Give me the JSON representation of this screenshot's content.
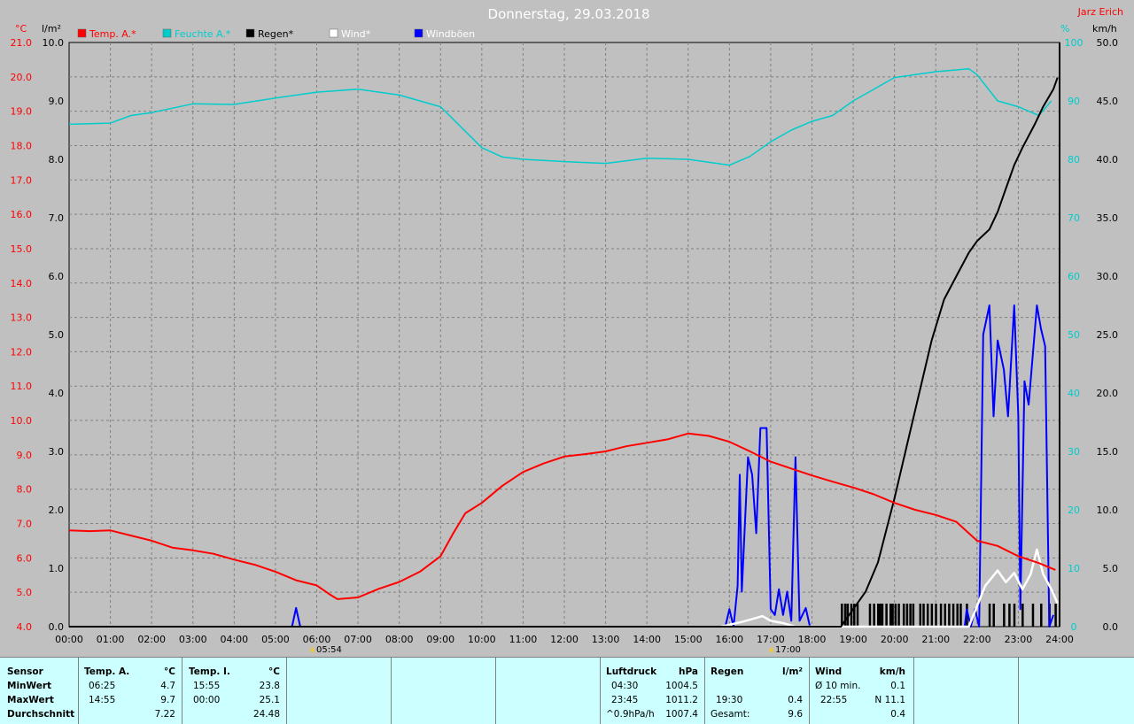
{
  "header": {
    "title": "Donnerstag, 29.03.2018",
    "author": "Jarz Erich"
  },
  "colors": {
    "temp": "#ff0000",
    "humidity": "#00cccc",
    "rain": "#000000",
    "wind": "#ffffff",
    "gust": "#0000ff",
    "background": "#c0c0c0",
    "grid": "#808080",
    "stats_bg": "#ccffff"
  },
  "axis_units": {
    "temp": "°C",
    "rain": "l/m²",
    "humidity": "%",
    "wind": "km/h"
  },
  "sun": {
    "sunrise": "05:54",
    "sunset": "17:00"
  },
  "chart_data": {
    "type": "line",
    "x_ticks": [
      "00:00",
      "01:00",
      "02:00",
      "03:00",
      "04:00",
      "05:00",
      "06:00",
      "07:00",
      "08:00",
      "09:00",
      "10:00",
      "11:00",
      "12:00",
      "13:00",
      "14:00",
      "15:00",
      "16:00",
      "17:00",
      "18:00",
      "19:00",
      "20:00",
      "21:00",
      "22:00",
      "23:00",
      "24:00"
    ],
    "xlim": [
      0,
      24
    ],
    "legend": [
      "Temp. A.*",
      "Feuchte A.*",
      "Regen*",
      "Wind*",
      "Windböen"
    ],
    "axes": {
      "temp": {
        "lim": [
          4.0,
          21.0
        ],
        "ticks": [
          4.0,
          5.0,
          6.0,
          7.0,
          8.0,
          9.0,
          10.0,
          11.0,
          12.0,
          13.0,
          14.0,
          15.0,
          16.0,
          17.0,
          18.0,
          19.0,
          20.0,
          21.0
        ]
      },
      "rain": {
        "lim": [
          0.0,
          10.0
        ],
        "ticks": [
          0.0,
          1.0,
          2.0,
          3.0,
          4.0,
          5.0,
          6.0,
          7.0,
          8.0,
          9.0,
          10.0
        ]
      },
      "humidity": {
        "lim": [
          0,
          100
        ],
        "ticks": [
          0,
          10,
          20,
          30,
          40,
          50,
          60,
          70,
          80,
          90,
          100
        ]
      },
      "wind": {
        "lim": [
          0.0,
          50.0
        ],
        "ticks": [
          0.0,
          5.0,
          10.0,
          15.0,
          20.0,
          25.0,
          30.0,
          35.0,
          40.0,
          45.0,
          50.0
        ]
      }
    },
    "series": [
      {
        "name": "Temp. A.*",
        "axis": "temp",
        "points": [
          [
            0,
            6.8
          ],
          [
            0.5,
            6.78
          ],
          [
            1,
            6.8
          ],
          [
            1.5,
            6.65
          ],
          [
            2,
            6.5
          ],
          [
            2.5,
            6.3
          ],
          [
            3,
            6.22
          ],
          [
            3.5,
            6.12
          ],
          [
            4,
            5.95
          ],
          [
            4.5,
            5.8
          ],
          [
            5,
            5.6
          ],
          [
            5.5,
            5.35
          ],
          [
            6,
            5.2
          ],
          [
            6.3,
            4.95
          ],
          [
            6.5,
            4.8
          ],
          [
            7,
            4.85
          ],
          [
            7.5,
            5.1
          ],
          [
            8,
            5.3
          ],
          [
            8.5,
            5.6
          ],
          [
            9,
            6.05
          ],
          [
            9.3,
            6.7
          ],
          [
            9.6,
            7.3
          ],
          [
            10,
            7.6
          ],
          [
            10.5,
            8.1
          ],
          [
            11,
            8.5
          ],
          [
            11.5,
            8.75
          ],
          [
            12,
            8.95
          ],
          [
            12.5,
            9.02
          ],
          [
            13,
            9.1
          ],
          [
            13.5,
            9.25
          ],
          [
            14,
            9.35
          ],
          [
            14.5,
            9.45
          ],
          [
            15,
            9.62
          ],
          [
            15.5,
            9.55
          ],
          [
            16,
            9.38
          ],
          [
            16.5,
            9.1
          ],
          [
            17,
            8.8
          ],
          [
            17.5,
            8.6
          ],
          [
            18,
            8.4
          ],
          [
            18.5,
            8.22
          ],
          [
            19,
            8.05
          ],
          [
            19.5,
            7.85
          ],
          [
            20,
            7.6
          ],
          [
            20.5,
            7.4
          ],
          [
            21,
            7.25
          ],
          [
            21.5,
            7.05
          ],
          [
            22,
            6.5
          ],
          [
            22.5,
            6.35
          ],
          [
            23,
            6.05
          ],
          [
            23.5,
            5.85
          ],
          [
            23.9,
            5.65
          ]
        ]
      },
      {
        "name": "Feuchte A.*",
        "axis": "humidity",
        "points": [
          [
            0,
            86
          ],
          [
            1,
            86.2
          ],
          [
            1.5,
            87.5
          ],
          [
            2,
            88
          ],
          [
            3,
            89.5
          ],
          [
            4,
            89.4
          ],
          [
            5,
            90.5
          ],
          [
            6,
            91.5
          ],
          [
            7,
            92
          ],
          [
            8,
            91
          ],
          [
            9,
            89
          ],
          [
            10,
            82
          ],
          [
            10.5,
            80.4
          ],
          [
            11,
            80
          ],
          [
            12,
            79.6
          ],
          [
            13,
            79.3
          ],
          [
            14,
            80.2
          ],
          [
            15,
            80
          ],
          [
            16,
            79
          ],
          [
            16.5,
            80.5
          ],
          [
            17,
            83
          ],
          [
            17.5,
            85
          ],
          [
            18,
            86.5
          ],
          [
            18.5,
            87.5
          ],
          [
            19,
            90
          ],
          [
            20,
            94
          ],
          [
            21,
            95
          ],
          [
            21.8,
            95.5
          ],
          [
            22,
            94.5
          ],
          [
            22.5,
            90
          ],
          [
            23,
            89
          ],
          [
            23.5,
            87.5
          ],
          [
            23.8,
            90
          ]
        ]
      },
      {
        "name": "Regen*",
        "axis": "rain",
        "points": [
          [
            0,
            0
          ],
          [
            18.7,
            0
          ],
          [
            19,
            0.3
          ],
          [
            19.3,
            0.6
          ],
          [
            19.6,
            1.1
          ],
          [
            20,
            2.2
          ],
          [
            20.3,
            3.1
          ],
          [
            20.6,
            4.0
          ],
          [
            20.9,
            4.9
          ],
          [
            21.2,
            5.6
          ],
          [
            21.5,
            6.0
          ],
          [
            21.8,
            6.4
          ],
          [
            22,
            6.6
          ],
          [
            22.3,
            6.8
          ],
          [
            22.5,
            7.1
          ],
          [
            22.7,
            7.5
          ],
          [
            22.9,
            7.9
          ],
          [
            23.1,
            8.2
          ],
          [
            23.4,
            8.6
          ],
          [
            23.6,
            8.9
          ],
          [
            23.85,
            9.2
          ],
          [
            23.95,
            9.4
          ]
        ]
      },
      {
        "name": "Wind*",
        "axis": "wind",
        "points": [
          [
            15.8,
            0
          ],
          [
            16.3,
            0.4
          ],
          [
            16.6,
            0.7
          ],
          [
            16.8,
            0.9
          ],
          [
            17,
            0.5
          ],
          [
            17.3,
            0.3
          ],
          [
            17.6,
            0
          ],
          [
            18,
            0
          ],
          [
            21.8,
            0
          ],
          [
            22.2,
            3.5
          ],
          [
            22.5,
            4.8
          ],
          [
            22.7,
            3.8
          ],
          [
            22.9,
            4.6
          ],
          [
            23.1,
            3.2
          ],
          [
            23.3,
            4.5
          ],
          [
            23.45,
            6.6
          ],
          [
            23.6,
            4.5
          ],
          [
            23.8,
            3.2
          ],
          [
            23.95,
            2.0
          ]
        ]
      },
      {
        "name": "Windböen",
        "axis": "gust",
        "points": [
          [
            0,
            0
          ],
          [
            5.4,
            0
          ],
          [
            5.5,
            1.6
          ],
          [
            5.6,
            0
          ],
          [
            15.9,
            0
          ],
          [
            16.0,
            1.5
          ],
          [
            16.1,
            0
          ],
          [
            16.2,
            3.5
          ],
          [
            16.25,
            13
          ],
          [
            16.3,
            3
          ],
          [
            16.45,
            14.5
          ],
          [
            16.55,
            13
          ],
          [
            16.65,
            8
          ],
          [
            16.75,
            17
          ],
          [
            16.9,
            17
          ],
          [
            17.0,
            1.5
          ],
          [
            17.1,
            1
          ],
          [
            17.2,
            3.2
          ],
          [
            17.3,
            1
          ],
          [
            17.4,
            3
          ],
          [
            17.5,
            0.5
          ],
          [
            17.6,
            14.5
          ],
          [
            17.7,
            0.5
          ],
          [
            17.85,
            1.6
          ],
          [
            17.95,
            0
          ],
          [
            21.7,
            0
          ],
          [
            21.75,
            1.5
          ],
          [
            21.85,
            0
          ],
          [
            21.95,
            1.5
          ],
          [
            22.05,
            0
          ],
          [
            22.15,
            25
          ],
          [
            22.3,
            27.5
          ],
          [
            22.4,
            18
          ],
          [
            22.5,
            24.5
          ],
          [
            22.65,
            22
          ],
          [
            22.75,
            18
          ],
          [
            22.9,
            27.5
          ],
          [
            23.0,
            18
          ],
          [
            23.05,
            1.5
          ],
          [
            23.15,
            21
          ],
          [
            23.25,
            19
          ],
          [
            23.45,
            27.5
          ],
          [
            23.55,
            25.5
          ],
          [
            23.65,
            24
          ],
          [
            23.75,
            0
          ],
          [
            23.85,
            1
          ]
        ]
      }
    ],
    "rain_bars": [
      18.72,
      18.8,
      18.86,
      18.95,
      19.02,
      19.1,
      19.4,
      19.5,
      19.6,
      19.65,
      19.7,
      19.8,
      19.9,
      19.95,
      20.02,
      20.1,
      20.22,
      20.3,
      20.38,
      20.45,
      20.62,
      20.7,
      20.8,
      20.9,
      21.0,
      21.12,
      21.22,
      21.32,
      21.42,
      21.52,
      21.6,
      21.75,
      22.3,
      22.4,
      22.65,
      22.78,
      22.9,
      23.1,
      23.35,
      23.55,
      23.75,
      23.9
    ]
  },
  "stats": {
    "sensor": {
      "header": "Sensor",
      "rows": [
        "MinWert",
        "MaxWert",
        "Durchschnitt"
      ]
    },
    "temp_a": {
      "header": "Temp. A.",
      "unit": "°C",
      "min_time": "06:25",
      "min_val": "4.7",
      "max_time": "14:55",
      "max_val": "9.7",
      "avg_val": "7.22"
    },
    "temp_i": {
      "header": "Temp. I.",
      "unit": "°C",
      "min_time": "15:55",
      "min_val": "23.8",
      "max_time": "00:00",
      "max_val": "25.1",
      "avg_val": "24.48"
    },
    "pressure": {
      "header": "Luftdruck",
      "unit": "hPa",
      "min_time": "04:30",
      "min_val": "1004.5",
      "max_time": "23:45",
      "max_val": "1011.2",
      "trend_label": "^0.9hPa/h",
      "avg_val": "1007.4"
    },
    "rain": {
      "header": "Regen",
      "unit": "l/m²",
      "max_time": "19:30",
      "max_val": "0.4",
      "total_label": "Gesamt:",
      "total_val": "9.6"
    },
    "wind": {
      "header": "Wind",
      "unit": "km/h",
      "min_label": "Ø 10 min.",
      "min_val": "0.1",
      "max_time": "22:55",
      "max_val": "N 11.1",
      "avg_val": "0.4"
    }
  }
}
